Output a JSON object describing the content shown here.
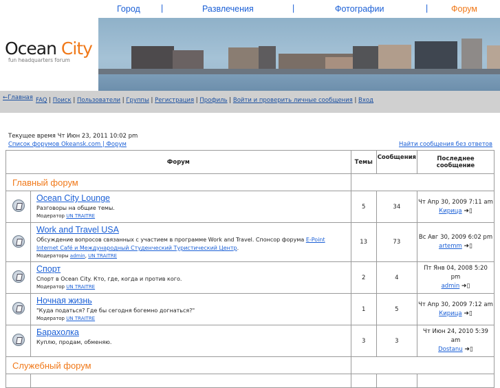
{
  "topnav": {
    "items": [
      {
        "label": "Город",
        "active": false
      },
      {
        "label": "Развлечения",
        "active": false
      },
      {
        "label": "Фотографии",
        "active": false
      },
      {
        "label": "Форум",
        "active": true
      }
    ],
    "separator": "|"
  },
  "logo": {
    "word1": "Ocean",
    "word2": "City",
    "tagline": "fun headquarters forum"
  },
  "menubar": {
    "home": "←Главная",
    "links": [
      "FAQ",
      "Поиск",
      "Пользователи",
      "Группы",
      "Регистрация",
      "Профиль",
      "Войти и проверить личные сообщения",
      "Вход"
    ]
  },
  "info": {
    "current_time": "Текущее время Чт Июн 23, 2011 10:02 pm",
    "breadcrumb": "Список форумов Okeansk.com | Форум",
    "unanswered_link": "Найти сообщения без ответов"
  },
  "table": {
    "headers": {
      "forum": "Форум",
      "topics": "Темы",
      "posts": "Сообщения",
      "last_post": "Последнее сообщение"
    },
    "categories": [
      {
        "name": "Главный форум",
        "forums": [
          {
            "name": "Ocean City Lounge",
            "desc": "Разговоры на общие темы.",
            "desc_link": "",
            "desc_after": "",
            "mod_label": "Модератор",
            "mods": [
              "UN TRAITRE"
            ],
            "topics": "5",
            "posts": "34",
            "last_date": "Чт Апр 30, 2009 7:11 am",
            "last_user": "Кирица"
          },
          {
            "name": "Work and Travel USA",
            "desc": "Обсуждение вопросов связанных с участием в программе Work and Travel. Спонсор форума ",
            "desc_link": "E-Point Internet Café и Международный Студенческий Туристический Центр",
            "desc_after": ".",
            "mod_label": "Модераторы",
            "mods": [
              "admin",
              "UN TRAITRE"
            ],
            "topics": "13",
            "posts": "73",
            "last_date": "Вс Авг 30, 2009 6:02 pm",
            "last_user": "artemm"
          },
          {
            "name": "Спорт",
            "desc": "Спорт в Ocean City. Кто, где, когда и против кого.",
            "desc_link": "",
            "desc_after": "",
            "mod_label": "Модератор",
            "mods": [
              "UN TRAITRE"
            ],
            "topics": "2",
            "posts": "4",
            "last_date": "Пт Янв 04, 2008 5:20 pm",
            "last_user": "admin"
          },
          {
            "name": "Ночная жизнь",
            "desc": "\"Куда податься? Где бы сегодня богемно догнаться?\"",
            "desc_link": "",
            "desc_after": "",
            "mod_label": "Модератор",
            "mods": [
              "UN TRAITRE"
            ],
            "topics": "1",
            "posts": "5",
            "last_date": "Чт Апр 30, 2009 7:12 am",
            "last_user": "Кирица"
          },
          {
            "name": "Барахолка",
            "desc": "Куплю, продам, обменяю.",
            "desc_link": "",
            "desc_after": "",
            "mod_label": "",
            "mods": [],
            "topics": "3",
            "posts": "3",
            "last_date": "Чт Июн 24, 2010 5:39 am",
            "last_user": "Dostanu"
          }
        ]
      },
      {
        "name": "Служебный форум",
        "forums": []
      }
    ]
  }
}
